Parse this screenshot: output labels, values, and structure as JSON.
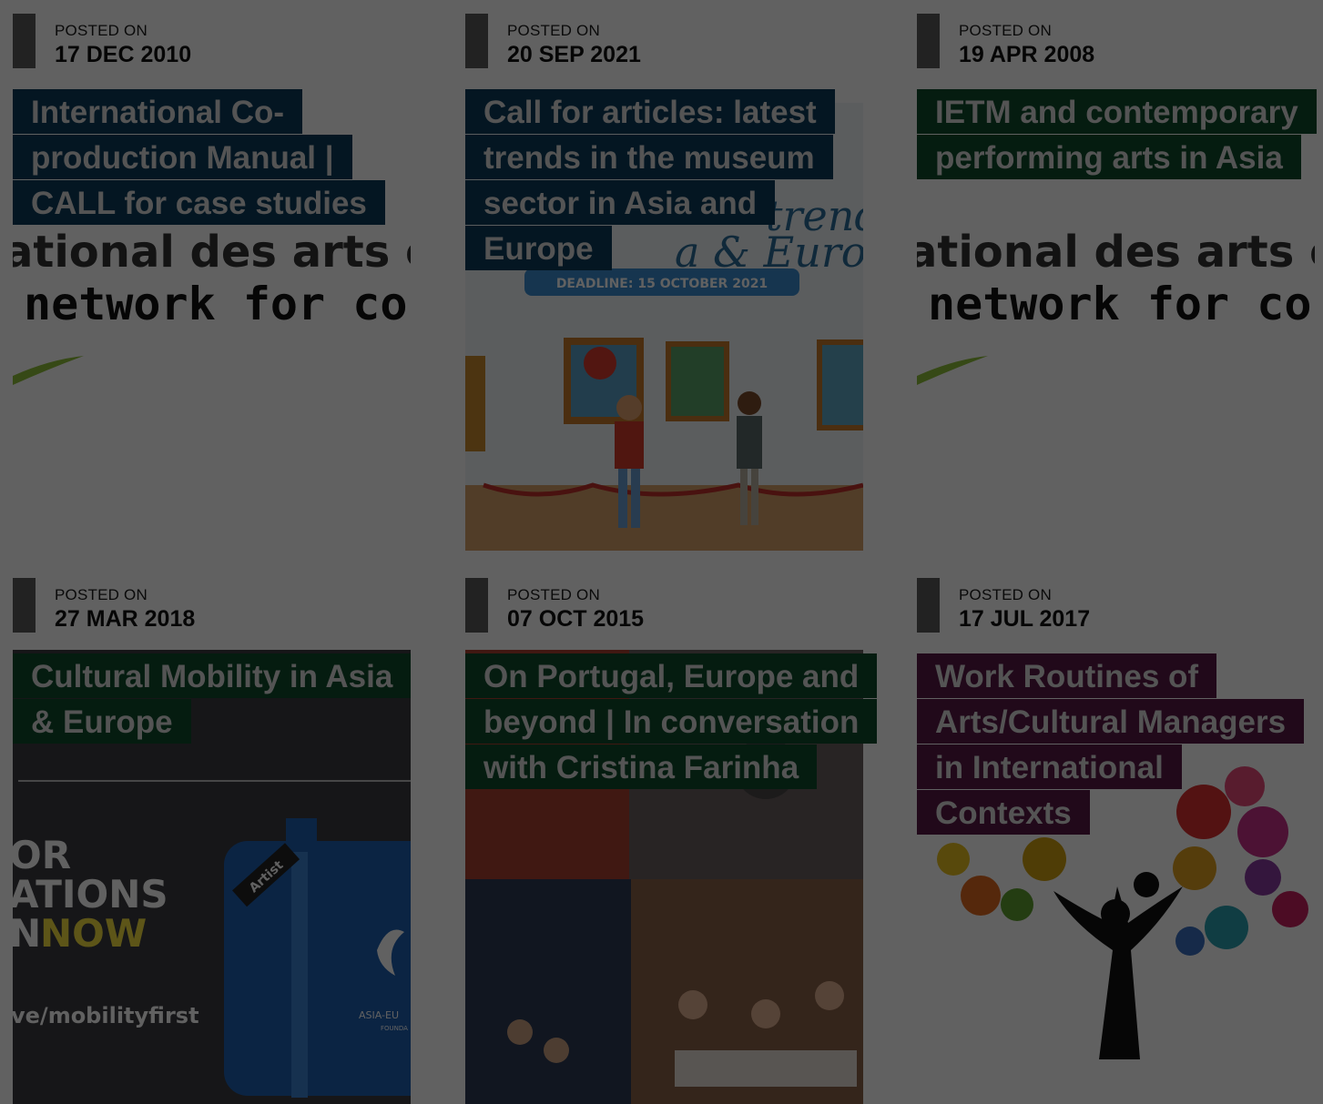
{
  "posts": [
    {
      "posted_label": "POSTED ON",
      "date": "17 DEC 2010",
      "title": "International Co-production Manual | CALL for case studies",
      "thumb_text": [
        "ational des arts c",
        "network for cont"
      ]
    },
    {
      "posted_label": "POSTED ON",
      "date": "20 SEP 2021",
      "title": "Call for articles: latest trends in the museum sector in Asia and Europe",
      "thumb_text": [
        "trend",
        "a & Europe",
        "DEADLINE:  15 OCTOBER 2021"
      ]
    },
    {
      "posted_label": "POSTED ON",
      "date": "19 APR 2008",
      "title": "IETM and contemporary performing arts in Asia",
      "thumb_text": [
        "ational des arts c",
        "network for cont"
      ]
    },
    {
      "posted_label": "POSTED ON",
      "date": "27 MAR 2018",
      "title": "Cultural Mobility in Asia & Europe",
      "thumb_text": [
        "OR",
        "ATIONS",
        "N",
        "NOW",
        "ve/mobilityfirst",
        "Artist",
        "ASIA-EU",
        "FOUNDA"
      ]
    },
    {
      "posted_label": "POSTED ON",
      "date": "07 OCT 2015",
      "title": "On Portugal, Europe and beyond | In conversation with Cristina Farinha"
    },
    {
      "posted_label": "POSTED ON",
      "date": "17 JUL 2017",
      "title": "Work Routines of Arts/Cultural Managers in International Contexts"
    }
  ],
  "colors": {
    "blue": "#0d3c5a",
    "green": "#0e4a2c",
    "purple": "#571a46",
    "dim_overlay": "rgba(0,0,0,0.62)"
  }
}
